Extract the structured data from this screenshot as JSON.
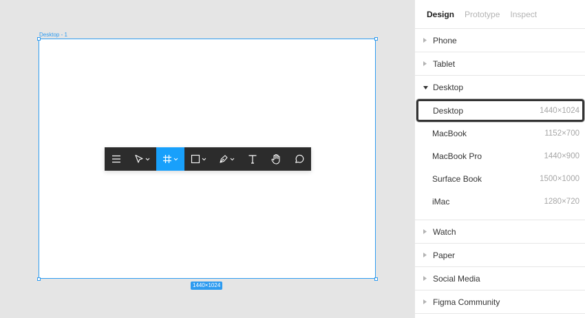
{
  "canvas": {
    "frame_label": "Desktop - 1",
    "frame_size_badge": "1440×1024"
  },
  "toolbar": {
    "tools": [
      {
        "name": "menu-icon"
      },
      {
        "name": "move-tool-icon"
      },
      {
        "name": "frame-tool-icon",
        "active": true
      },
      {
        "name": "shape-tool-icon"
      },
      {
        "name": "pen-tool-icon"
      },
      {
        "name": "text-tool-icon"
      },
      {
        "name": "hand-tool-icon"
      },
      {
        "name": "comment-tool-icon"
      }
    ],
    "accent": "#18a0fb"
  },
  "panel": {
    "tabs": [
      {
        "label": "Design",
        "active": true
      },
      {
        "label": "Prototype"
      },
      {
        "label": "Inspect"
      }
    ],
    "sections": [
      {
        "label": "Phone"
      },
      {
        "label": "Tablet"
      },
      {
        "label": "Desktop",
        "expanded": true,
        "items": [
          {
            "name": "Desktop",
            "size": "1440×1024",
            "selected": true
          },
          {
            "name": "MacBook",
            "size": "1152×700"
          },
          {
            "name": "MacBook Pro",
            "size": "1440×900"
          },
          {
            "name": "Surface Book",
            "size": "1500×1000"
          },
          {
            "name": "iMac",
            "size": "1280×720"
          }
        ]
      },
      {
        "label": "Watch"
      },
      {
        "label": "Paper"
      },
      {
        "label": "Social Media"
      },
      {
        "label": "Figma Community"
      }
    ]
  },
  "colors": {
    "selection_blue": "#2d9bf0",
    "toolbar_bg": "#2c2c2c"
  }
}
